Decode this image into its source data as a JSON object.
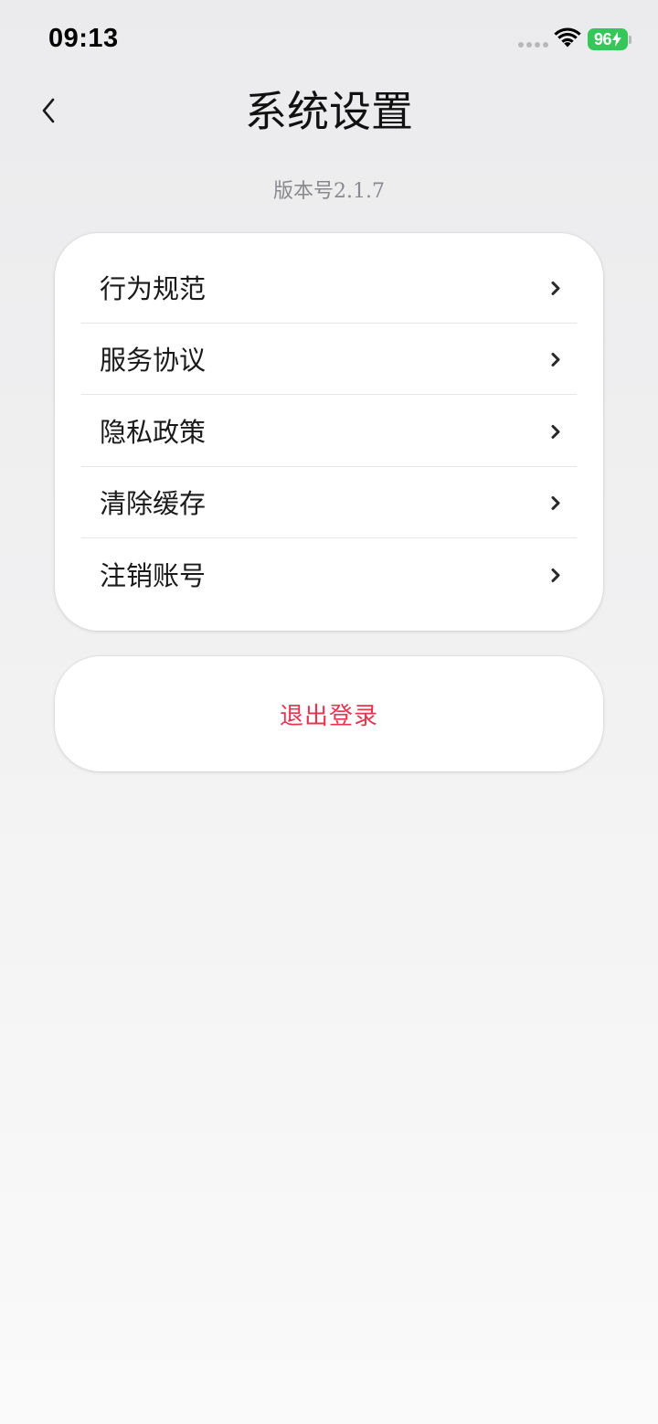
{
  "status_bar": {
    "time": "09:13",
    "battery": "96",
    "battery_color": "#35c759",
    "icons": [
      "signal-icon",
      "wifi-icon",
      "battery-charging-icon"
    ]
  },
  "header": {
    "back_icon": "chevron-left-icon",
    "title": "系统设置"
  },
  "version_text": "版本号2.1.7",
  "menu": {
    "items": [
      {
        "label": "行为规范",
        "icon": "chevron-right-icon"
      },
      {
        "label": "服务协议",
        "icon": "chevron-right-icon"
      },
      {
        "label": "隐私政策",
        "icon": "chevron-right-icon"
      },
      {
        "label": "清除缓存",
        "icon": "chevron-right-icon"
      },
      {
        "label": "注销账号",
        "icon": "chevron-right-icon"
      }
    ]
  },
  "logout": {
    "label": "退出登录",
    "color": "#e8344f"
  }
}
